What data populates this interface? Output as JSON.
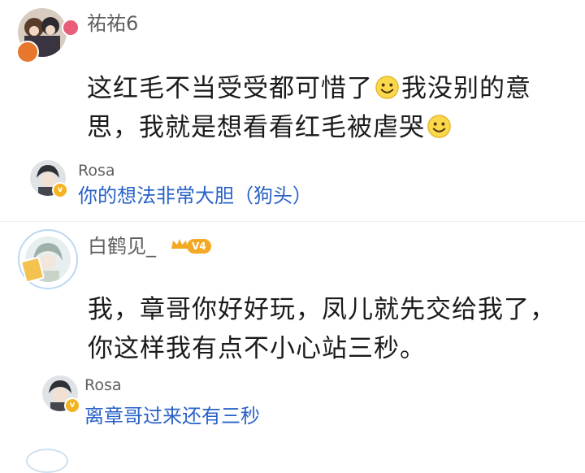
{
  "comments": [
    {
      "username": "祐祐6",
      "content_lines": [
        {
          "before": "这红毛不当受受都可惜了",
          "emoji": "smile-emoji",
          "after": "我没别的意"
        },
        {
          "before": "思，我就是想看看红毛被虐哭",
          "emoji": "smile-emoji",
          "after": ""
        }
      ],
      "reply": {
        "username": "Rosa",
        "text": "你的想法非常大胆（狗头）"
      }
    },
    {
      "username": "白鹤见_",
      "level_badge": "V4",
      "content_lines": [
        "我，章哥你好好玩，凤儿就先交给我了，",
        "你这样我有点不小心站三秒。"
      ],
      "reply": {
        "username": "Rosa",
        "text": "离章哥过来还有三秒"
      }
    }
  ],
  "colors": {
    "username": "#5f5f5f",
    "content": "#1b1b1b",
    "reply_text": "#2862c8",
    "vip_badge": "#f5b320",
    "level_badge": "#f3a923"
  }
}
